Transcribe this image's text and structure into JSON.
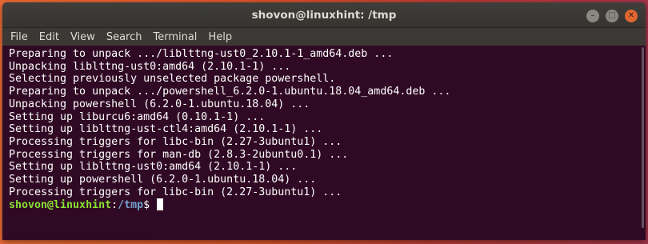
{
  "window": {
    "title": "shovon@linuxhint: /tmp",
    "controls": [
      "minimize-icon",
      "maximize-icon",
      "close-icon"
    ]
  },
  "menu": [
    "File",
    "Edit",
    "View",
    "Search",
    "Terminal",
    "Help"
  ],
  "terminal": {
    "lines": [
      "Preparing to unpack .../liblttng-ust0_2.10.1-1_amd64.deb ...",
      "Unpacking liblttng-ust0:amd64 (2.10.1-1) ...",
      "Selecting previously unselected package powershell.",
      "Preparing to unpack .../powershell_6.2.0-1.ubuntu.18.04_amd64.deb ...",
      "Unpacking powershell (6.2.0-1.ubuntu.18.04) ...",
      "Setting up liburcu6:amd64 (0.10.1-1) ...",
      "Setting up liblttng-ust-ctl4:amd64 (2.10.1-1) ...",
      "Processing triggers for libc-bin (2.27-3ubuntu1) ...",
      "Processing triggers for man-db (2.8.3-2ubuntu0.1) ...",
      "Setting up liblttng-ust0:amd64 (2.10.1-1) ...",
      "Setting up powershell (6.2.0-1.ubuntu.18.04) ...",
      "Processing triggers for libc-bin (2.27-3ubuntu1) ..."
    ],
    "prompt": {
      "user_host": "shovon@linuxhint",
      "separator": ":",
      "path": "/tmp",
      "symbol": "$ "
    }
  },
  "colors": {
    "terminal_bg": "#300a24",
    "prompt_user": "#8ae234",
    "prompt_path": "#729fcf",
    "close_button": "#e1662f"
  }
}
